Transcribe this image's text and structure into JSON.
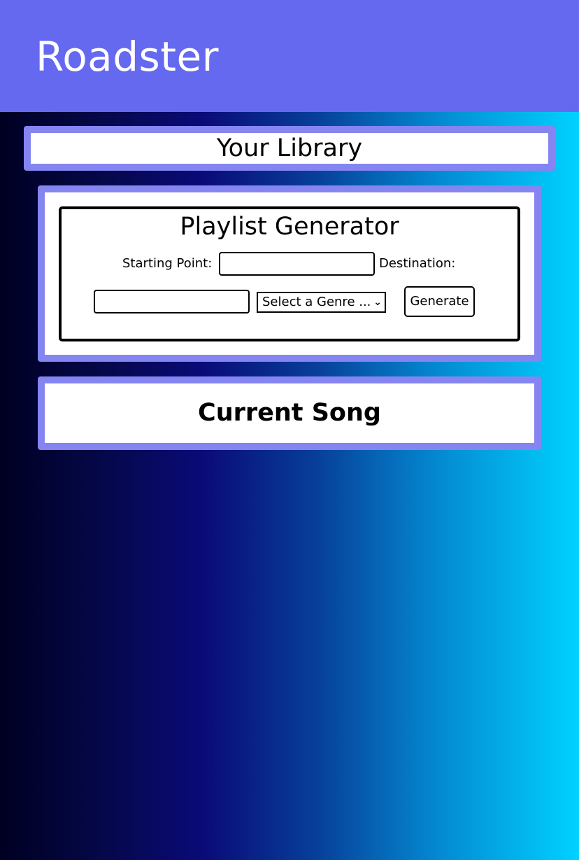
{
  "header": {
    "title": "Roadster"
  },
  "library": {
    "title": "Your Library"
  },
  "playlist_generator": {
    "title": "Playlist Generator",
    "starting_point_label": "Starting Point:",
    "starting_point_value": "",
    "destination_label": "Destination:",
    "destination_value": "",
    "genre_select_value": "Select a Genre ...",
    "generate_label": "Generate"
  },
  "current_song": {
    "title": "Current Song"
  },
  "colors": {
    "header_bg": "#6569f0",
    "panel_border": "#8585f2",
    "gradient_start": "#000022",
    "gradient_end": "#00d2ff"
  }
}
